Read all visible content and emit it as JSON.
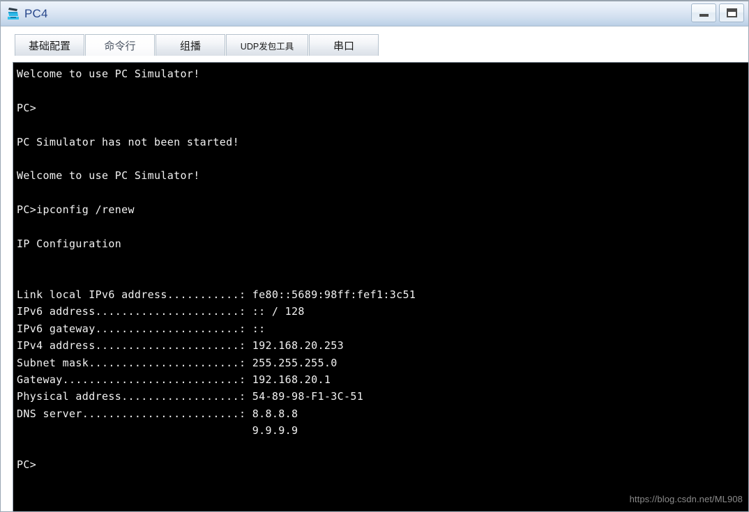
{
  "window": {
    "title": "PC4",
    "icon": "pc-simulator-icon",
    "controls": [
      {
        "name": "minimize-button",
        "glyph": "minimize"
      },
      {
        "name": "maximize-button",
        "glyph": "maximize"
      }
    ]
  },
  "tabs": [
    {
      "id": "basic-config",
      "label": "基础配置",
      "selected": false,
      "small": false
    },
    {
      "id": "command-line",
      "label": "命令行",
      "selected": true,
      "small": false
    },
    {
      "id": "multicast",
      "label": "组播",
      "selected": false,
      "small": false
    },
    {
      "id": "udp-packet-tool",
      "label": "UDP发包工具",
      "selected": false,
      "small": true
    },
    {
      "id": "serial-port",
      "label": "串口",
      "selected": false,
      "small": false
    }
  ],
  "terminal": {
    "background_color": "#000000",
    "text_color": "#f2f2f2",
    "lines": [
      "Welcome to use PC Simulator!",
      "",
      "PC>",
      "",
      "PC Simulator has not been started!",
      "",
      "Welcome to use PC Simulator!",
      "",
      "PC>ipconfig /renew",
      "",
      "IP Configuration",
      "",
      "",
      "Link local IPv6 address...........: fe80::5689:98ff:fef1:3c51",
      "IPv6 address......................: :: / 128",
      "IPv6 gateway......................: ::",
      "IPv4 address......................: 192.168.20.253",
      "Subnet mask.......................: 255.255.255.0",
      "Gateway...........................: 192.168.20.1",
      "Physical address..................: 54-89-98-F1-3C-51",
      "DNS server........................: 8.8.8.8",
      "                                    9.9.9.9",
      "",
      "PC>",
      ""
    ]
  },
  "watermark": {
    "text": "https://blog.csdn.net/ML908"
  }
}
